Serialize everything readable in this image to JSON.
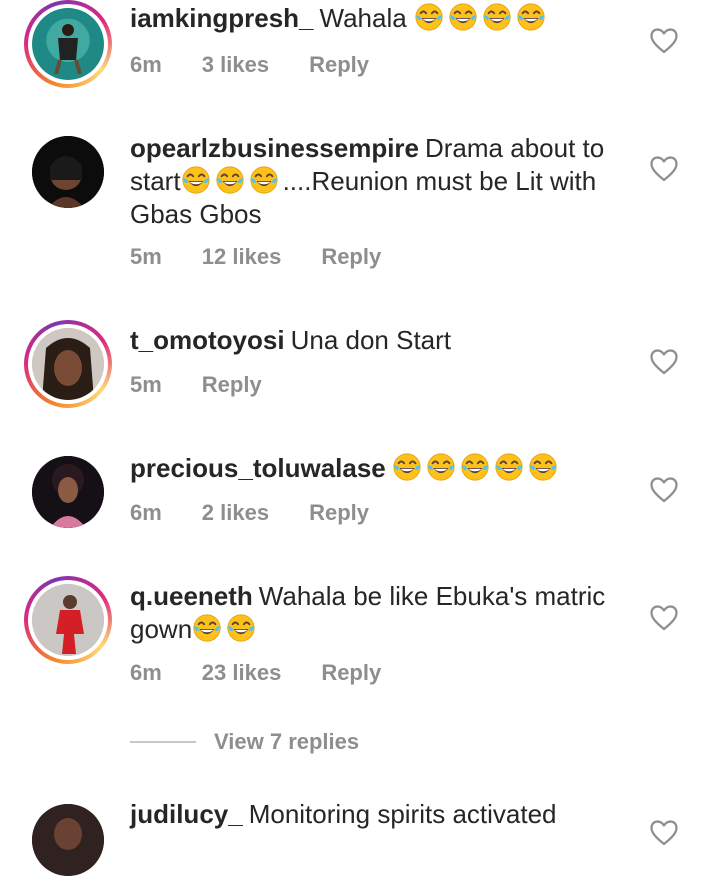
{
  "comments": [
    {
      "username": "iamkingpresh_",
      "text": "Wahala",
      "emoji_after": 4,
      "time": "6m",
      "likes": "3 likes",
      "reply": "Reply",
      "story_ring": true
    },
    {
      "username": "opearlzbusinessempire",
      "text_a": "Drama about to start",
      "emoji_mid": 3,
      "text_b": "....Reunion must be Lit with Gbas Gbos",
      "time": "5m",
      "likes": "12 likes",
      "reply": "Reply",
      "story_ring": false
    },
    {
      "username": "t_omotoyosi",
      "text": "Una don Start",
      "time": "5m",
      "reply": "Reply",
      "story_ring": true
    },
    {
      "username": "precious_toluwalase",
      "text": "",
      "emoji_after": 5,
      "time": "6m",
      "likes": "2 likes",
      "reply": "Reply",
      "story_ring": false
    },
    {
      "username": "q.ueeneth",
      "text": "Wahala be like Ebuka's matric gown",
      "emoji_after": 2,
      "time": "6m",
      "likes": "23 likes",
      "reply": "Reply",
      "story_ring": true
    },
    {
      "username": "judilucy_",
      "text": "Monitoring spirits activated",
      "story_ring": false
    }
  ],
  "view_replies": "View 7 replies",
  "icons": {
    "emoji": "face-with-tears-of-joy-icon",
    "like": "heart-outline-icon"
  },
  "colors": {
    "text": "#262626",
    "muted": "#8e8e8e"
  }
}
